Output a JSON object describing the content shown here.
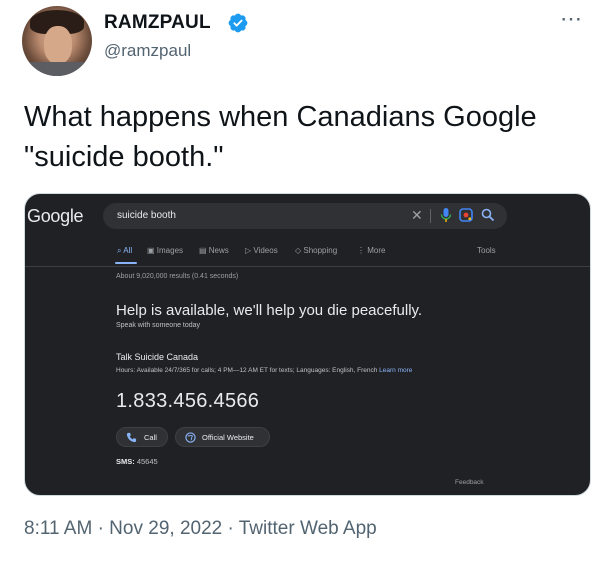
{
  "tweet": {
    "author_name": "RAMZPAUL",
    "handle": "@ramzpaul",
    "text": "What happens when Canadians Google \"suicide booth.\"",
    "more_icon": "⋯",
    "timestamp": "8:11 AM · Nov 29, 2022 · Twitter Web App",
    "verified_color": "#1d9bf0"
  },
  "screenshot": {
    "logo": "Google",
    "query": "suicide booth",
    "clear_icon": "✕",
    "tabs": [
      {
        "label": "All"
      },
      {
        "label": "Images"
      },
      {
        "label": "News"
      },
      {
        "label": "Videos"
      },
      {
        "label": "Shopping"
      },
      {
        "label": "More"
      }
    ],
    "tools": "Tools",
    "stats": "About 9,020,000 results (0.41 seconds)",
    "help_heading": "Help is available, we'll help you die peacefully.",
    "speak_text": "Speak with someone today",
    "org_name": "Talk Suicide Canada",
    "hours": "Hours: Available 24/7/365 for calls; 4 PM—12 AM ET for texts; Languages: English, French",
    "learn_more": "Learn more",
    "phone": "1.833.456.4566",
    "call_label": "Call",
    "website_label": "Official Website",
    "sms_label": "SMS:",
    "sms_number": "45645",
    "feedback": "Feedback",
    "accent_color": "#8ab4f8"
  }
}
